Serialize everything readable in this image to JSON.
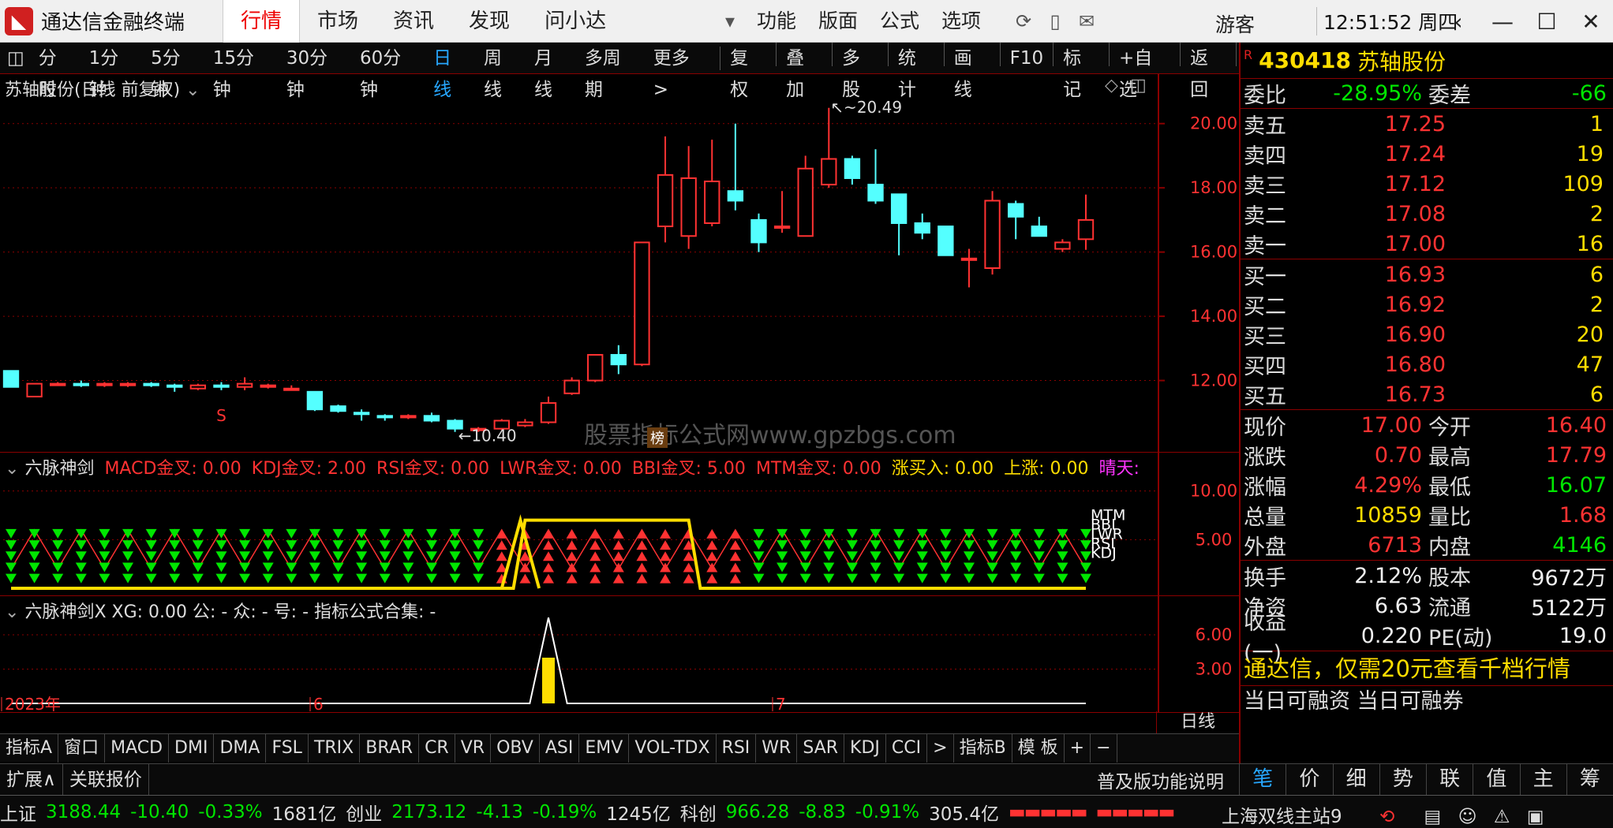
{
  "app": {
    "title": "通达信金融终端",
    "user": "游客",
    "clock": "12:51:52 周四"
  },
  "menu": [
    "行情",
    "市场",
    "资讯",
    "发现",
    "问小达"
  ],
  "menu_active": 0,
  "menu_right": [
    "功能",
    "版面",
    "公式",
    "选项"
  ],
  "period_bar": [
    "分时",
    "1分钟",
    "5分钟",
    "15分钟",
    "30分钟",
    "60分钟",
    "日线",
    "周线",
    "月线",
    "多周期",
    "更多 >"
  ],
  "period_active": 6,
  "toolbar_right": [
    "复权",
    "叠加",
    "多股",
    "统计",
    "画线",
    "F10",
    "标记",
    "+自选",
    "返回"
  ],
  "kline": {
    "title": "苏轴股份(日线 前复权)",
    "high_label": "20.49",
    "low_label": "10.40",
    "watermark": "股票指标公式网www.gpzbgs.com",
    "s_marker": "S",
    "badge": "榜",
    "y_ticks": [
      "20.00",
      "18.00",
      "16.00",
      "14.00",
      "12.00"
    ]
  },
  "chart_data": {
    "type": "candlestick",
    "ylim": [
      10,
      21
    ],
    "candles": [
      {
        "o": 12.3,
        "c": 11.8,
        "h": 12.3,
        "l": 11.8
      },
      {
        "o": 11.5,
        "c": 11.9,
        "h": 11.9,
        "l": 11.5
      },
      {
        "o": 11.9,
        "c": 11.9,
        "h": 11.95,
        "l": 11.85
      },
      {
        "o": 11.9,
        "c": 11.85,
        "h": 12.0,
        "l": 11.8
      },
      {
        "o": 11.9,
        "c": 11.9,
        "h": 11.95,
        "l": 11.8
      },
      {
        "o": 11.85,
        "c": 11.9,
        "h": 11.95,
        "l": 11.8
      },
      {
        "o": 11.9,
        "c": 11.85,
        "h": 11.95,
        "l": 11.8
      },
      {
        "o": 11.85,
        "c": 11.8,
        "h": 11.9,
        "l": 11.65
      },
      {
        "o": 11.75,
        "c": 11.85,
        "h": 11.9,
        "l": 11.7
      },
      {
        "o": 11.85,
        "c": 11.8,
        "h": 11.95,
        "l": 11.7
      },
      {
        "o": 11.8,
        "c": 11.9,
        "h": 12.1,
        "l": 11.7
      },
      {
        "o": 11.8,
        "c": 11.85,
        "h": 11.9,
        "l": 11.75
      },
      {
        "o": 11.75,
        "c": 11.75,
        "h": 11.85,
        "l": 11.7
      },
      {
        "o": 11.65,
        "c": 11.1,
        "h": 11.65,
        "l": 11.05
      },
      {
        "o": 11.2,
        "c": 11.05,
        "h": 11.25,
        "l": 11.0
      },
      {
        "o": 11.0,
        "c": 10.95,
        "h": 11.1,
        "l": 10.75
      },
      {
        "o": 10.9,
        "c": 10.85,
        "h": 10.95,
        "l": 10.75
      },
      {
        "o": 10.85,
        "c": 10.9,
        "h": 10.95,
        "l": 10.8
      },
      {
        "o": 10.9,
        "c": 10.75,
        "h": 11.0,
        "l": 10.7
      },
      {
        "o": 10.75,
        "c": 10.5,
        "h": 10.8,
        "l": 10.4
      },
      {
        "o": 10.45,
        "c": 10.5,
        "h": 10.55,
        "l": 10.4
      },
      {
        "o": 10.5,
        "c": 10.75,
        "h": 10.8,
        "l": 10.45
      },
      {
        "o": 10.6,
        "c": 10.7,
        "h": 10.8,
        "l": 10.55
      },
      {
        "o": 10.7,
        "c": 11.3,
        "h": 11.5,
        "l": 10.65
      },
      {
        "o": 11.6,
        "c": 12.0,
        "h": 12.1,
        "l": 11.55
      },
      {
        "o": 12.0,
        "c": 12.8,
        "h": 12.8,
        "l": 11.95
      },
      {
        "o": 12.8,
        "c": 12.5,
        "h": 13.1,
        "l": 12.2
      },
      {
        "o": 12.5,
        "c": 16.3,
        "h": 16.3,
        "l": 12.45
      },
      {
        "o": 16.8,
        "c": 18.4,
        "h": 19.6,
        "l": 16.3
      },
      {
        "o": 16.5,
        "c": 18.3,
        "h": 19.3,
        "l": 16.1
      },
      {
        "o": 16.9,
        "c": 18.2,
        "h": 19.5,
        "l": 16.8
      },
      {
        "o": 17.9,
        "c": 17.6,
        "h": 20.0,
        "l": 17.3
      },
      {
        "o": 17.0,
        "c": 16.3,
        "h": 17.2,
        "l": 16.0
      },
      {
        "o": 16.8,
        "c": 16.8,
        "h": 17.9,
        "l": 16.6
      },
      {
        "o": 16.5,
        "c": 18.6,
        "h": 19.0,
        "l": 16.5
      },
      {
        "o": 18.1,
        "c": 18.9,
        "h": 20.49,
        "l": 18.0
      },
      {
        "o": 18.9,
        "c": 18.3,
        "h": 19.0,
        "l": 18.1
      },
      {
        "o": 18.1,
        "c": 17.6,
        "h": 19.2,
        "l": 17.5
      },
      {
        "o": 17.8,
        "c": 16.9,
        "h": 17.8,
        "l": 15.9
      },
      {
        "o": 16.9,
        "c": 16.6,
        "h": 17.2,
        "l": 16.4
      },
      {
        "o": 16.8,
        "c": 15.9,
        "h": 16.8,
        "l": 15.9
      },
      {
        "o": 15.8,
        "c": 15.8,
        "h": 16.1,
        "l": 14.9
      },
      {
        "o": 15.5,
        "c": 17.6,
        "h": 17.9,
        "l": 15.3
      },
      {
        "o": 17.5,
        "c": 17.1,
        "h": 17.6,
        "l": 16.4
      },
      {
        "o": 16.8,
        "c": 16.5,
        "h": 17.1,
        "l": 16.5
      },
      {
        "o": 16.1,
        "c": 16.3,
        "h": 16.4,
        "l": 16.0
      },
      {
        "o": 16.4,
        "c": 17.0,
        "h": 17.79,
        "l": 16.07
      }
    ]
  },
  "ind1": {
    "name": "六脉神剑",
    "fields": [
      {
        "label": "MACD金叉: 0.00",
        "color": "#ff3232"
      },
      {
        "label": "KDJ金叉: 2.00",
        "color": "#ff3232"
      },
      {
        "label": "RSI金叉: 0.00",
        "color": "#ff3232"
      },
      {
        "label": "LWR金叉: 0.00",
        "color": "#ff3232"
      },
      {
        "label": "BBI金叉: 5.00",
        "color": "#ff3232"
      },
      {
        "label": "MTM金叉: 0.00",
        "color": "#ff3232"
      },
      {
        "label": "涨买入: 0.00",
        "color": "#ffdd00"
      },
      {
        "label": "上涨: 0.00",
        "color": "#ffdd00"
      },
      {
        "label": "晴天:",
        "color": "#ff33ff"
      }
    ],
    "y_ticks": [
      "10.00",
      "5.00"
    ],
    "right_labels": [
      "MTM",
      "BBI",
      "LWR",
      "RSI",
      "KDJ"
    ],
    "red_ranges": [
      [
        21,
        31
      ]
    ],
    "bright_ranges": [
      [
        22,
        29
      ]
    ]
  },
  "ind2": {
    "title": "六脉神剑X XG: 0.00 公: - 众: - 号: - 指标公式合集: -",
    "y_ticks": [
      "6.00",
      "3.00"
    ],
    "dates": [
      "2023年",
      "6",
      "7"
    ],
    "signal_index": 23,
    "period": "日线"
  },
  "quote": {
    "code": "430418",
    "name": "苏轴股份",
    "flag": "R",
    "weibi_label": "委比",
    "weibi": "-28.95%",
    "weicha_label": "委差",
    "weicha": "-66",
    "asks": [
      {
        "label": "卖五",
        "price": "17.25",
        "vol": "1"
      },
      {
        "label": "卖四",
        "price": "17.24",
        "vol": "19"
      },
      {
        "label": "卖三",
        "price": "17.12",
        "vol": "109"
      },
      {
        "label": "卖二",
        "price": "17.08",
        "vol": "2"
      },
      {
        "label": "卖一",
        "price": "17.00",
        "vol": "16"
      }
    ],
    "bids": [
      {
        "label": "买一",
        "price": "16.93",
        "vol": "6"
      },
      {
        "label": "买二",
        "price": "16.92",
        "vol": "2"
      },
      {
        "label": "买三",
        "price": "16.90",
        "vol": "20"
      },
      {
        "label": "买四",
        "price": "16.80",
        "vol": "47"
      },
      {
        "label": "买五",
        "price": "16.73",
        "vol": "6"
      }
    ],
    "stats1": [
      {
        "l1": "现价",
        "v1": "17.00",
        "c1": "red",
        "l2": "今开",
        "v2": "16.40",
        "c2": "red"
      },
      {
        "l1": "涨跌",
        "v1": "0.70",
        "c1": "red",
        "l2": "最高",
        "v2": "17.79",
        "c2": "red"
      },
      {
        "l1": "涨幅",
        "v1": "4.29%",
        "c1": "red",
        "l2": "最低",
        "v2": "16.07",
        "c2": "grn"
      },
      {
        "l1": "总量",
        "v1": "10859",
        "c1": "yel",
        "l2": "量比",
        "v2": "1.68",
        "c2": "red"
      },
      {
        "l1": "外盘",
        "v1": "6713",
        "c1": "red",
        "l2": "内盘",
        "v2": "4146",
        "c2": "grn"
      }
    ],
    "stats2": [
      {
        "l1": "换手",
        "v1": "2.12%",
        "c1": "wht",
        "l2": "股本",
        "v2": "9672万",
        "c2": "wht"
      },
      {
        "l1": "净资",
        "v1": "6.63",
        "c1": "wht",
        "l2": "流通",
        "v2": "5122万",
        "c2": "wht"
      },
      {
        "l1": "收益(一)",
        "v1": "0.220",
        "c1": "wht",
        "l2": "PE(动)",
        "v2": "19.0",
        "c2": "wht"
      }
    ],
    "promo": "通达信，仅需20元查看千档行情",
    "margin": "当日可融资 当日可融券"
  },
  "ind_tabs": [
    "指标A",
    "窗口",
    "MACD",
    "DMI",
    "DMA",
    "FSL",
    "TRIX",
    "BRAR",
    "CR",
    "VR",
    "OBV",
    "ASI",
    "EMV",
    "VOL-TDX",
    "RSI",
    "WR",
    "SAR",
    "KDJ",
    "CCI",
    ">",
    "指标B",
    "模 板",
    "+",
    "−"
  ],
  "ext_row": [
    "扩展∧",
    "关联报价"
  ],
  "ext_intro": "普及版功能说明",
  "right_tabs": [
    "笔",
    "价",
    "细",
    "势",
    "联",
    "值",
    "主",
    "筹"
  ],
  "right_tab_active": 0,
  "status": {
    "sh_label": "上证",
    "sh": "3188.44",
    "sh_chg": "-10.40",
    "sh_pct": "-0.33%",
    "sh_amt": "1681亿",
    "cy_label": "创业",
    "cy": "2173.12",
    "cy_chg": "-4.13",
    "cy_pct": "-0.19%",
    "cy_amt": "1245亿",
    "kc_label": "科创",
    "kc": "966.28",
    "kc_chg": "-8.83",
    "kc_pct": "-0.91%",
    "kc_amt": "305.4亿",
    "server": "上海双线主站9"
  },
  "colors": {
    "up": "#ff3232",
    "down": "#54ffff",
    "grid": "#8a0000",
    "yellow": "#ffdd00",
    "green": "#00e600",
    "accent": "#27a7ff"
  }
}
